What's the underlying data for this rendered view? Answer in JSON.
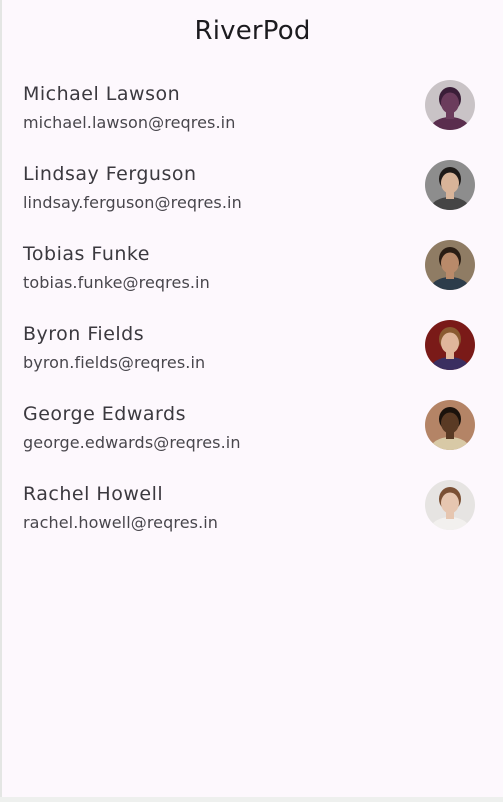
{
  "app_bar": {
    "title": "RiverPod"
  },
  "users": [
    {
      "name": "Michael Lawson",
      "email": "michael.lawson@reqres.in",
      "avatar": {
        "bg": "#c9c3c6",
        "skin": "#6b3c5c",
        "hair": "#3a1e38",
        "shirt": "#5a2e4e"
      }
    },
    {
      "name": "Lindsay Ferguson",
      "email": "lindsay.ferguson@reqres.in",
      "avatar": {
        "bg": "#8d8d8d",
        "skin": "#d8b499",
        "hair": "#1e1a18",
        "shirt": "#454545"
      }
    },
    {
      "name": "Tobias Funke",
      "email": "tobias.funke@reqres.in",
      "avatar": {
        "bg": "#8f7c64",
        "skin": "#b98a6a",
        "hair": "#2a1d14",
        "shirt": "#2d3c4a"
      }
    },
    {
      "name": "Byron Fields",
      "email": "byron.fields@reqres.in",
      "avatar": {
        "bg": "#7a1a18",
        "skin": "#e0b69b",
        "hair": "#8a5a30",
        "shirt": "#3a2e60"
      }
    },
    {
      "name": "George Edwards",
      "email": "george.edwards@reqres.in",
      "avatar": {
        "bg": "#b48466",
        "skin": "#5a3a24",
        "hair": "#1a120c",
        "shirt": "#d8c9a6"
      }
    },
    {
      "name": "Rachel Howell",
      "email": "rachel.howell@reqres.in",
      "avatar": {
        "bg": "#e6e4e2",
        "skin": "#e6c6b0",
        "hair": "#7a5034",
        "shirt": "#f2f0ee"
      }
    }
  ]
}
